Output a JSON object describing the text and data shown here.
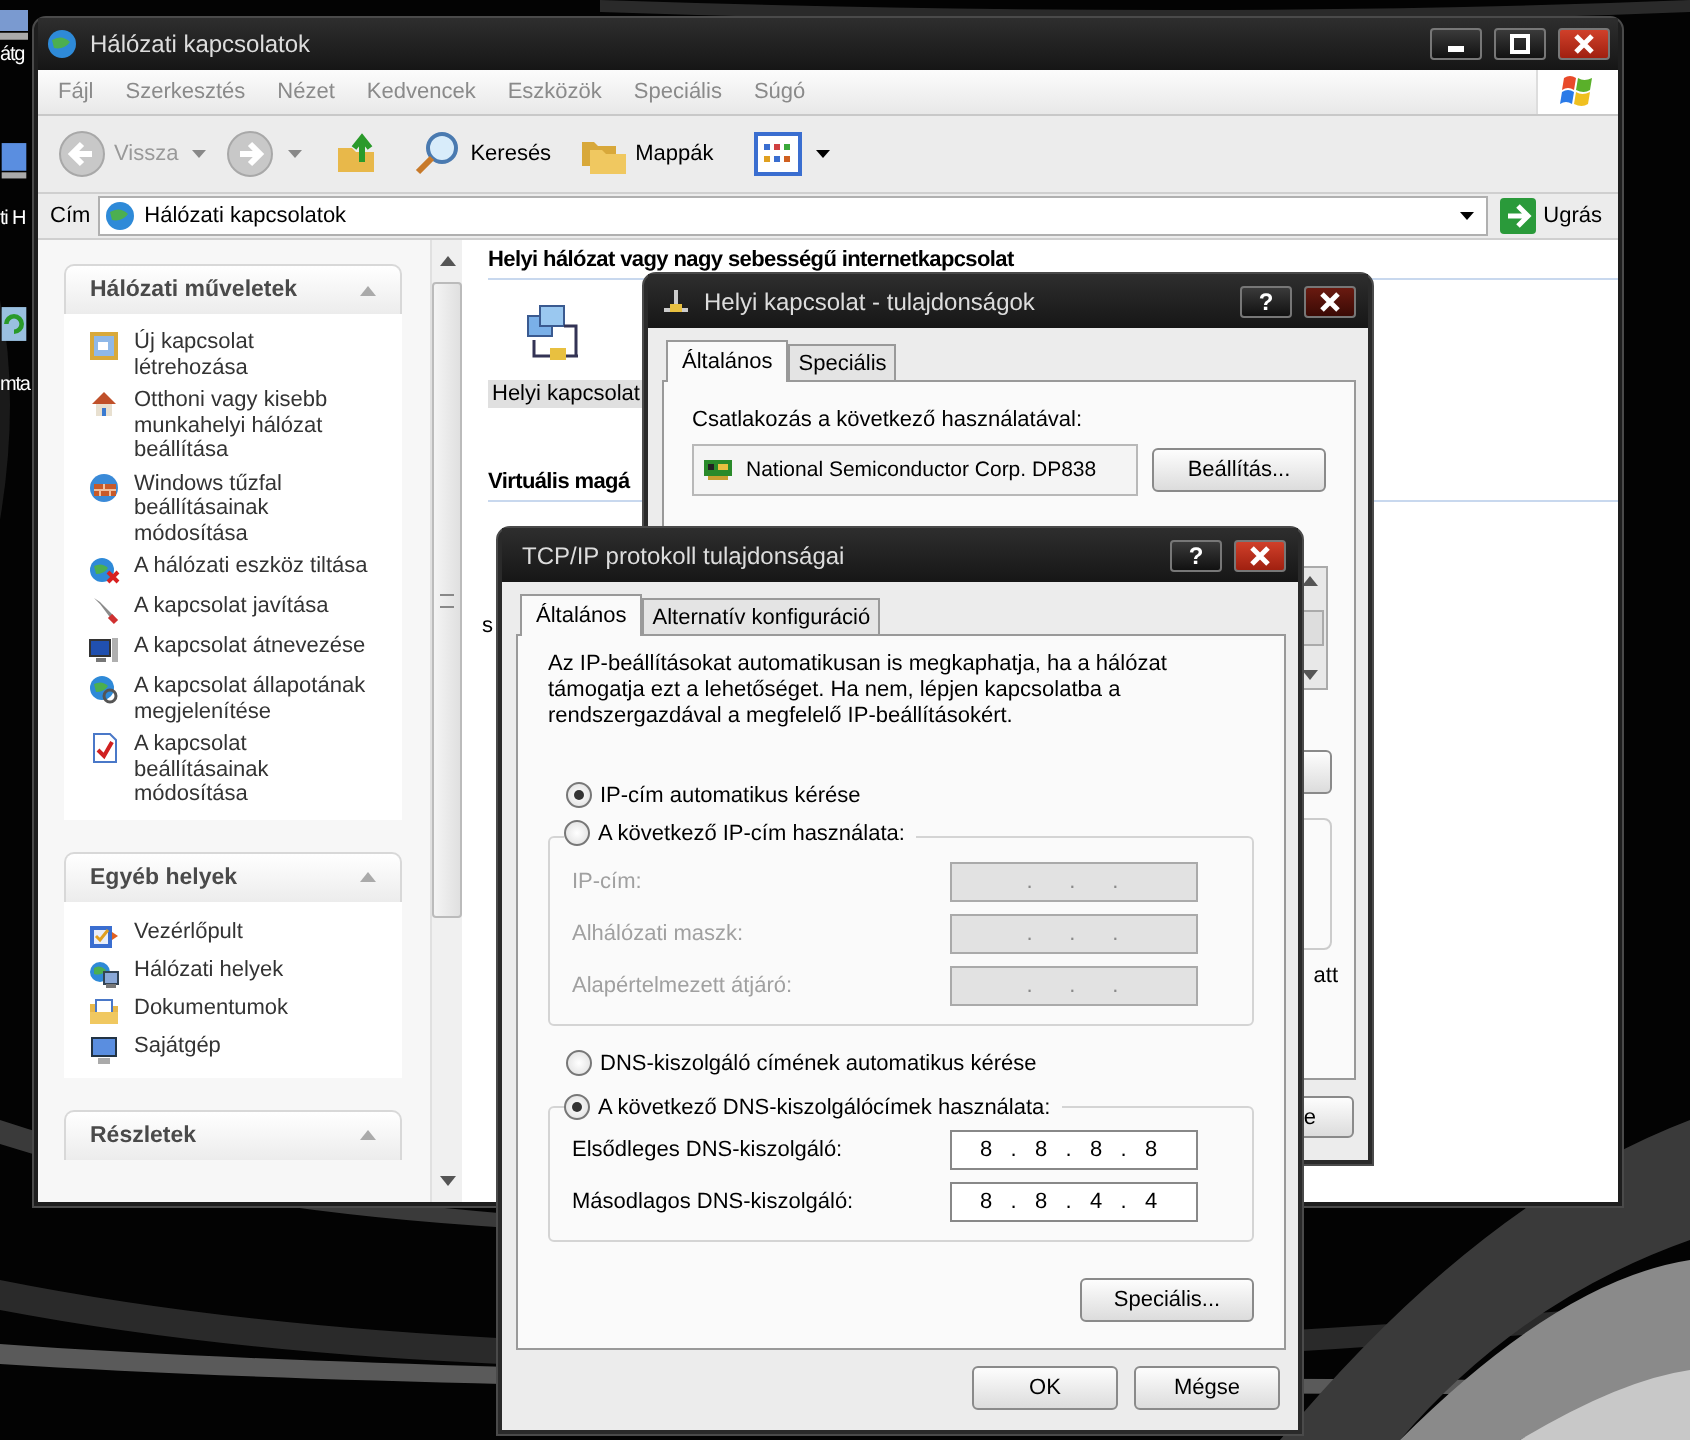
{
  "desktop": {
    "icon_labels": [
      "átg",
      "ti H",
      "mta"
    ]
  },
  "explorer": {
    "title": "Hálózati kapcsolatok",
    "menu": [
      "Fájl",
      "Szerkesztés",
      "Nézet",
      "Kedvencek",
      "Eszközök",
      "Speciális",
      "Súgó"
    ],
    "toolbar": [
      {
        "kind": "back",
        "label": "Vissza",
        "disabled": true
      },
      {
        "kind": "forward",
        "disabled": true
      },
      {
        "kind": "up"
      },
      {
        "kind": "search",
        "label": "Keresés"
      },
      {
        "kind": "folders",
        "label": "Mappák"
      },
      {
        "kind": "views"
      }
    ],
    "address": {
      "label": "Cím",
      "value": "Hálózati kapcsolatok",
      "go": "Ugrás"
    },
    "sidebar": [
      {
        "title": "Hálózati műveletek",
        "expanded": true,
        "items": [
          "Új kapcsolat\nlétrehozása",
          "Otthoni vagy kisebb\nmunkahelyi hálózat\nbeállítása",
          "Windows tűzfal\nbeállításainak\nmódosítása",
          "A hálózati eszköz tiltása",
          "A kapcsolat javítása",
          "A kapcsolat átnevezése",
          "A kapcsolat állapotának\nmegjelenítése",
          "A kapcsolat\nbeállításainak\nmódosítása"
        ]
      },
      {
        "title": "Egyéb helyek",
        "expanded": true,
        "items": [
          "Vezérlőpult",
          "Hálózati helyek",
          "Dokumentumok",
          "Sajátgép"
        ]
      },
      {
        "title": "Részletek",
        "expanded": true
      }
    ],
    "content": {
      "groups": [
        {
          "title": "Helyi hálózat vagy nagy sebességű internetkapcsolat",
          "items": [
            {
              "label": "Helyi kapcsolat",
              "selected": true
            }
          ]
        },
        {
          "title": "Virtuális magá"
        }
      ],
      "partial_text": "s"
    }
  },
  "connection_dialog": {
    "title": "Helyi kapcsolat - tulajdonságok",
    "help": "?",
    "tabs": [
      {
        "label": "Általános",
        "selected": true
      },
      {
        "label": "Speciális",
        "selected": false
      }
    ],
    "connect_label": "Csatlakozás a következő használatával:",
    "adapter": "National Semiconductor Corp. DP838",
    "configure_button": "Beállítás...",
    "partial_text": "att",
    "partial_button": "e"
  },
  "tcp_dialog": {
    "title": "TCP/IP protokoll tulajdonságai",
    "help": "?",
    "tabs": [
      {
        "label": "Általános",
        "selected": true
      },
      {
        "label": "Alternatív konfiguráció",
        "selected": false
      }
    ],
    "description": "Az IP-beállításokat automatikusan is megkaphatja, ha a hálózat\ntámogatja ezt a lehetőséget. Ha nem, lépjen kapcsolatba a\nrendszergazdával a megfelelő IP-beállításokért.",
    "ip_options": [
      {
        "label": "IP-cím automatikus kérése",
        "selected": true
      },
      {
        "label": "A következő IP-cím használata:",
        "selected": false
      }
    ],
    "ip_fields": [
      {
        "label": "IP-cím:",
        "value": "     .      .      .",
        "disabled": true
      },
      {
        "label": "Alhálózati maszk:",
        "value": "     .      .      .",
        "disabled": true
      },
      {
        "label": "Alapértelmezett átjáró:",
        "value": "     .      .      .",
        "disabled": true
      }
    ],
    "dns_options": [
      {
        "label": "DNS-kiszolgáló címének automatikus kérése",
        "selected": false
      },
      {
        "label": "A következő DNS-kiszolgálócímek használata:",
        "selected": true
      }
    ],
    "dns_fields": [
      {
        "label": "Elsődleges DNS-kiszolgáló:",
        "value": "8   .   8   .   8   .   8",
        "disabled": false
      },
      {
        "label": "Másodlagos DNS-kiszolgáló:",
        "value": "8   .   8   .   4   .   4",
        "disabled": false
      }
    ],
    "advanced_button": "Speciális...",
    "ok_button": "OK",
    "cancel_button": "Mégse"
  }
}
